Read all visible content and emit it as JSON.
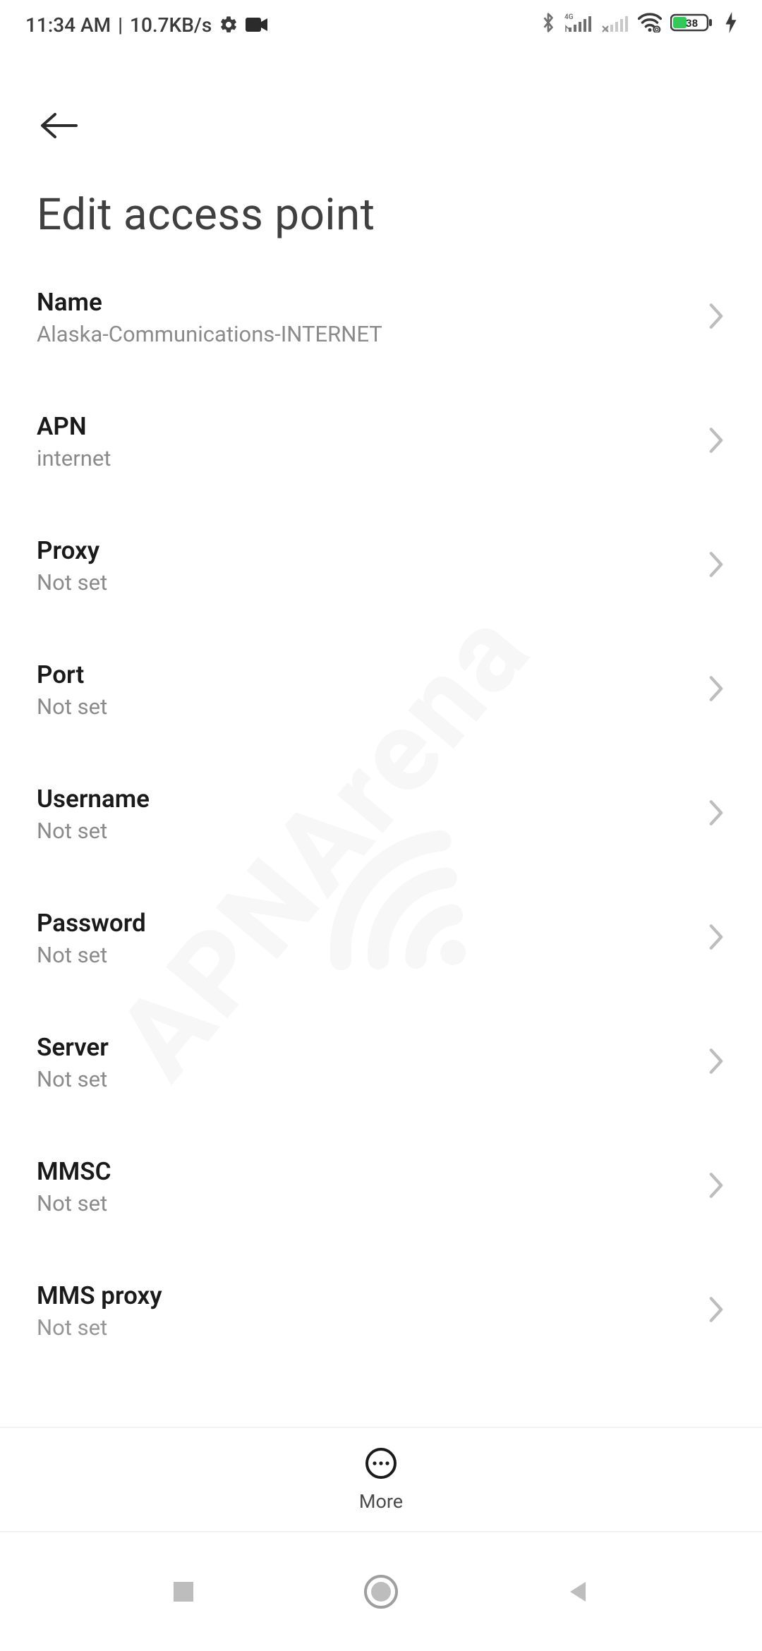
{
  "status_bar": {
    "time": "11:34 AM",
    "separator": "|",
    "net_speed": "10.7KB/s",
    "battery_percent": "38"
  },
  "header": {
    "title": "Edit access point"
  },
  "settings": [
    {
      "key": "name",
      "label": "Name",
      "value": "Alaska-Communications-INTERNET"
    },
    {
      "key": "apn",
      "label": "APN",
      "value": "internet"
    },
    {
      "key": "proxy",
      "label": "Proxy",
      "value": "Not set"
    },
    {
      "key": "port",
      "label": "Port",
      "value": "Not set"
    },
    {
      "key": "username",
      "label": "Username",
      "value": "Not set"
    },
    {
      "key": "password",
      "label": "Password",
      "value": "Not set"
    },
    {
      "key": "server",
      "label": "Server",
      "value": "Not set"
    },
    {
      "key": "mmsc",
      "label": "MMSC",
      "value": "Not set"
    },
    {
      "key": "mms_proxy",
      "label": "MMS proxy",
      "value": "Not set"
    }
  ],
  "actions": {
    "more_label": "More"
  },
  "watermark": {
    "text": "APNArena"
  }
}
